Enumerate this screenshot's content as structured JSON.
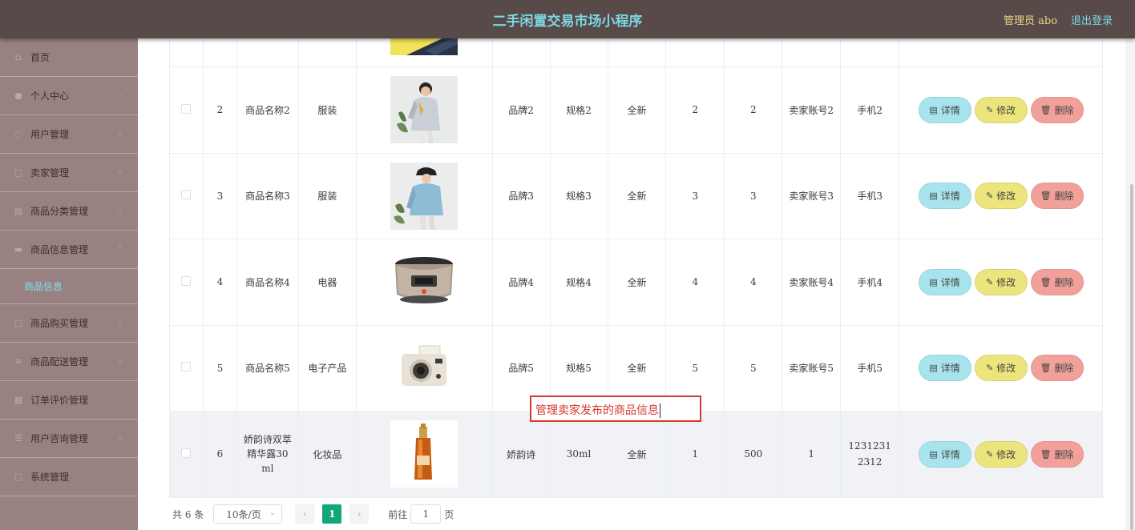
{
  "header": {
    "title": "二手闲置交易市场小程序",
    "admin": "管理员 abo",
    "logout": "退出登录"
  },
  "sidebar": {
    "items": [
      {
        "label": "首页",
        "icon": "home-icon",
        "expandable": false
      },
      {
        "label": "个人中心",
        "icon": "user-icon",
        "expandable": true
      },
      {
        "label": "用户管理",
        "icon": "users-icon",
        "expandable": true
      },
      {
        "label": "卖家管理",
        "icon": "seller-icon",
        "expandable": true
      },
      {
        "label": "商品分类管理",
        "icon": "category-icon",
        "expandable": true
      },
      {
        "label": "商品信息管理",
        "icon": "goods-icon",
        "expandable": true,
        "expanded": true
      },
      {
        "label": "商品购买管理",
        "icon": "cart-icon",
        "expandable": true
      },
      {
        "label": "商品配送管理",
        "icon": "delivery-icon",
        "expandable": true
      },
      {
        "label": "订单评价管理",
        "icon": "review-icon",
        "expandable": true
      },
      {
        "label": "用户咨询管理",
        "icon": "consult-icon",
        "expandable": true
      },
      {
        "label": "系统管理",
        "icon": "system-icon",
        "expandable": false
      }
    ],
    "active_sub": "商品信息"
  },
  "table": {
    "rows": [
      {
        "id": "2",
        "name": "商品名称2",
        "category": "服装",
        "brand": "品牌2",
        "spec": "规格2",
        "condition": "全新",
        "c1": "2",
        "c2": "2",
        "seller": "卖家账号2",
        "phone": "手机2",
        "image": "jacket-photo"
      },
      {
        "id": "3",
        "name": "商品名称3",
        "category": "服装",
        "brand": "品牌3",
        "spec": "规格3",
        "condition": "全新",
        "c1": "3",
        "c2": "3",
        "seller": "卖家账号3",
        "phone": "手机3",
        "image": "hoodie-photo"
      },
      {
        "id": "4",
        "name": "商品名称4",
        "category": "电器",
        "brand": "品牌4",
        "spec": "规格4",
        "condition": "全新",
        "c1": "4",
        "c2": "4",
        "seller": "卖家账号4",
        "phone": "手机4",
        "image": "rice-cooker-photo"
      },
      {
        "id": "5",
        "name": "商品名称5",
        "category": "电子产品",
        "brand": "品牌5",
        "spec": "规格5",
        "condition": "全新",
        "c1": "5",
        "c2": "5",
        "seller": "卖家账号5",
        "phone": "手机5",
        "image": "instant-camera-photo"
      },
      {
        "id": "6",
        "name": "娇韵诗双萃精华露30ml",
        "category": "化妆品",
        "brand": "娇韵诗",
        "spec": "30ml",
        "condition": "全新",
        "c1": "1",
        "c2": "500",
        "seller": "1",
        "phone": "12312312312",
        "image": "serum-bottle-photo"
      }
    ],
    "actions": {
      "detail": "详情",
      "edit": "修改",
      "delete": "删除"
    }
  },
  "pagination": {
    "total": "共 6 条",
    "page_size": "10条/页",
    "current_page": "1",
    "goto_label": "前往",
    "goto_value": "1",
    "page_suffix": "页"
  },
  "annotation": {
    "text": "管理卖家发布的商品信息"
  },
  "colors": {
    "header_bg": "#574a48",
    "title": "#7cd8e4",
    "sidebar_bg": "#9a8181",
    "active_sub": "#7ce3ee",
    "detail_btn": "#a8e4ee",
    "edit_btn": "#ece47c",
    "delete_btn": "#f2a19a",
    "page_active": "#11a67b"
  }
}
